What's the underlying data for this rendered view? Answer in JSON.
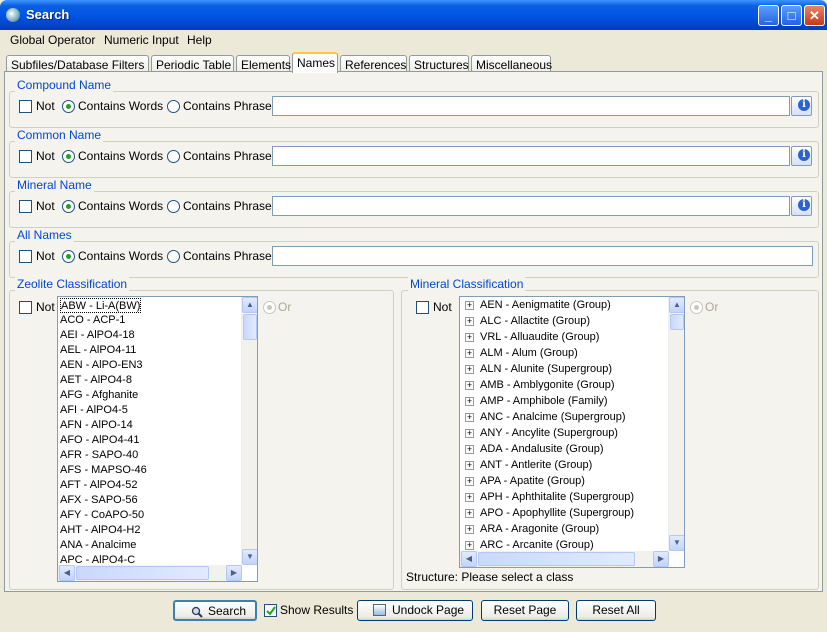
{
  "window": {
    "title": "Search"
  },
  "menu": [
    "Global Operator",
    "Numeric Input",
    "Help"
  ],
  "tabs": [
    "Subfiles/Database Filters",
    "Periodic Table",
    "Elements",
    "Names",
    "References",
    "Structures",
    "Miscellaneous"
  ],
  "active_tab": "Names",
  "text_options": {
    "not": "Not",
    "contains_words": "Contains Words",
    "contains_phrase": "Contains Phrase"
  },
  "name_groups": [
    {
      "title": "Compound Name",
      "value": ""
    },
    {
      "title": "Common Name",
      "value": ""
    },
    {
      "title": "Mineral Name",
      "value": ""
    },
    {
      "title": "All Names",
      "value": ""
    }
  ],
  "zeolite": {
    "title": "Zeolite Classification",
    "not": "Not",
    "or": "Or",
    "items": [
      "ABW - Li-A(BW)",
      "ACO - ACP-1",
      "AEI - AlPO4-18",
      "AEL - AlPO4-11",
      "AEN - AlPO-EN3",
      "AET - AlPO4-8",
      "AFG - Afghanite",
      "AFI - AlPO4-5",
      "AFN - AlPO-14",
      "AFO - AlPO4-41",
      "AFR - SAPO-40",
      "AFS - MAPSO-46",
      "AFT - AlPO4-52",
      "AFX - SAPO-56",
      "AFY - CoAPO-50",
      "AHT - AlPO4-H2",
      "ANA - Analcime",
      "APC - AlPO4-C"
    ]
  },
  "mineral": {
    "title": "Mineral Classification",
    "not": "Not",
    "or": "Or",
    "status": "Structure: Please select a class",
    "items": [
      "AEN - Aenigmatite  (Group)",
      "ALC - Allactite  (Group)",
      "VRL - Alluaudite  (Group)",
      "ALM - Alum  (Group)",
      "ALN - Alunite  (Supergroup)",
      "AMB - Amblygonite  (Group)",
      "AMP - Amphibole  (Family)",
      "ANC - Analcime  (Supergroup)",
      "ANY - Ancylite  (Supergroup)",
      "ADA - Andalusite  (Group)",
      "ANT - Antlerite  (Group)",
      "APA - Apatite  (Group)",
      "APH - Aphthitalite  (Supergroup)",
      "APO - Apophyllite  (Supergroup)",
      "ARA - Aragonite  (Group)",
      "ARC - Arcanite  (Group)"
    ]
  },
  "footer": {
    "search": "Search",
    "show_results": "Show Results",
    "undock": "Undock Page",
    "reset_page": "Reset Page",
    "reset_all": "Reset All"
  },
  "colors": {
    "title_bar": "#0055E5",
    "group_label": "#0046D5",
    "active_tab_accent": "#FFC83C"
  }
}
